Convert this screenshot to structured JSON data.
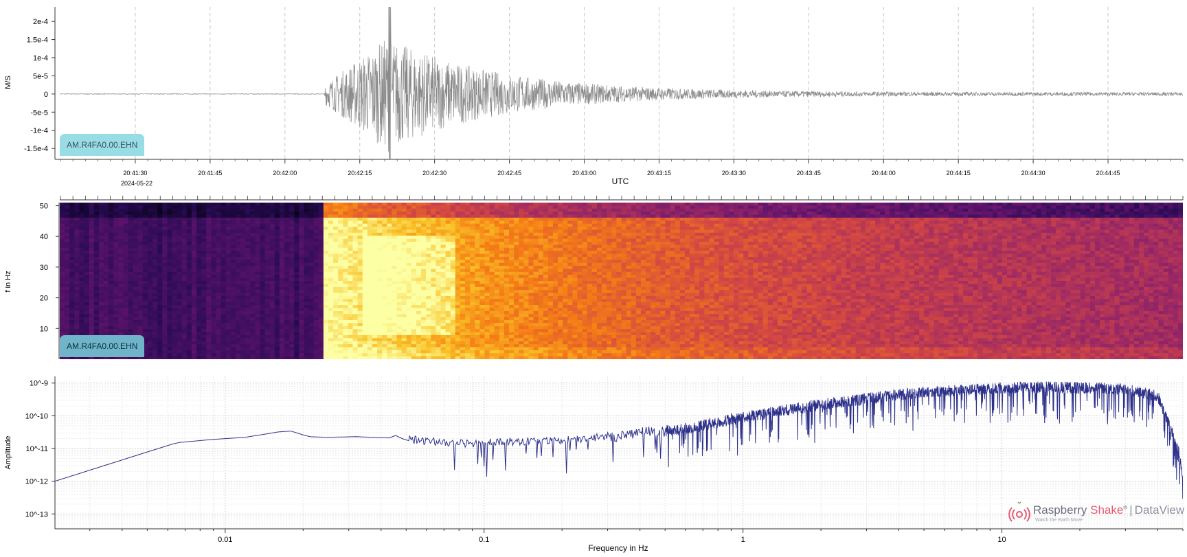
{
  "colors": {
    "waveform": "#8a8a8a",
    "spectrum": "#2e318a",
    "spectrum_low": "#7d76c0",
    "label_light": "#98dde6",
    "label_dark": "#6fb4c9"
  },
  "chart_data": [
    {
      "type": "line",
      "name": "waveform",
      "station_label": "AM.R4FA0.00.EHN",
      "ylabel": "M/S",
      "xlabel": "UTC",
      "date_label": "2024-05-22",
      "yticks": [
        "2e-4",
        "1.5e-4",
        "1e-4",
        "5e-5",
        "0",
        "-5e-5",
        "-1e-4",
        "-1.5e-4"
      ],
      "ytick_values": [
        0.0002,
        0.00015,
        0.0001,
        5e-05,
        0,
        -5e-05,
        -0.0001,
        -0.00015
      ],
      "ylim": [
        -0.00018,
        0.00024
      ],
      "xticks": [
        "20:41:30",
        "20:41:45",
        "20:42:00",
        "20:42:15",
        "20:42:30",
        "20:42:45",
        "20:43:00",
        "20:43:15",
        "20:43:30",
        "20:43:45",
        "20:44:00",
        "20:44:15",
        "20:44:30",
        "20:44:45"
      ],
      "xlim": [
        "20:41:15",
        "20:45:00"
      ],
      "event_onset": "20:42:08",
      "peak_time": "20:42:21",
      "peak_amplitude": 0.00024,
      "grid": true
    },
    {
      "type": "heatmap",
      "name": "spectrogram",
      "station_label": "AM.R4FA0.00.EHN",
      "ylabel": "f in Hz",
      "yticks": [
        "50",
        "40",
        "30",
        "20",
        "10"
      ],
      "ytick_values": [
        50,
        40,
        30,
        20,
        10
      ],
      "ylim": [
        0,
        51
      ],
      "xlim": [
        "20:41:15",
        "20:45:00"
      ],
      "colormap": "inferno",
      "event_onset": "20:42:08"
    },
    {
      "type": "line",
      "name": "amplitude spectrum",
      "ylabel": "Amplitude",
      "xlabel": "Frequency in Hz",
      "xscale": "log",
      "yscale": "log",
      "xticks": [
        "0.01",
        "0.1",
        "1",
        "10"
      ],
      "xtick_values": [
        0.01,
        0.1,
        1,
        10
      ],
      "yticks": [
        "10^-9",
        "10^-10",
        "10^-11",
        "10^-12",
        "10^-13"
      ],
      "ytick_values": [
        1e-09,
        1e-10,
        1e-11,
        1e-12,
        1e-13
      ],
      "xlim": [
        0.0022,
        50
      ],
      "ylim": [
        3.5e-14,
        1.6e-09
      ],
      "grid": true,
      "x": [
        0.0022,
        0.0045,
        0.0065,
        0.009,
        0.012,
        0.016,
        0.018,
        0.021,
        0.025,
        0.032,
        0.043,
        0.06,
        0.085,
        0.12,
        0.2,
        0.35,
        0.6,
        1,
        2,
        4,
        8,
        15,
        30,
        40,
        48,
        50
      ],
      "values": [
        1e-12,
        6e-12,
        1.5e-11,
        1.9e-11,
        2.2e-11,
        3.2e-11,
        3.4e-11,
        2.3e-11,
        2.2e-11,
        2.3e-11,
        2.1e-11,
        1.7e-11,
        1.4e-11,
        1.6e-11,
        1.8e-11,
        2.6e-11,
        4e-11,
        9e-11,
        2.2e-10,
        4.5e-10,
        6.5e-10,
        7.5e-10,
        6.5e-10,
        4e-10,
        1e-11,
        1.5e-12
      ]
    }
  ],
  "branding": {
    "word1": "Raspberry ",
    "word2": "Shake",
    "reg": "®",
    "separator": "|",
    "product": "DataView",
    "tagline": "Watch the Earth Move"
  }
}
